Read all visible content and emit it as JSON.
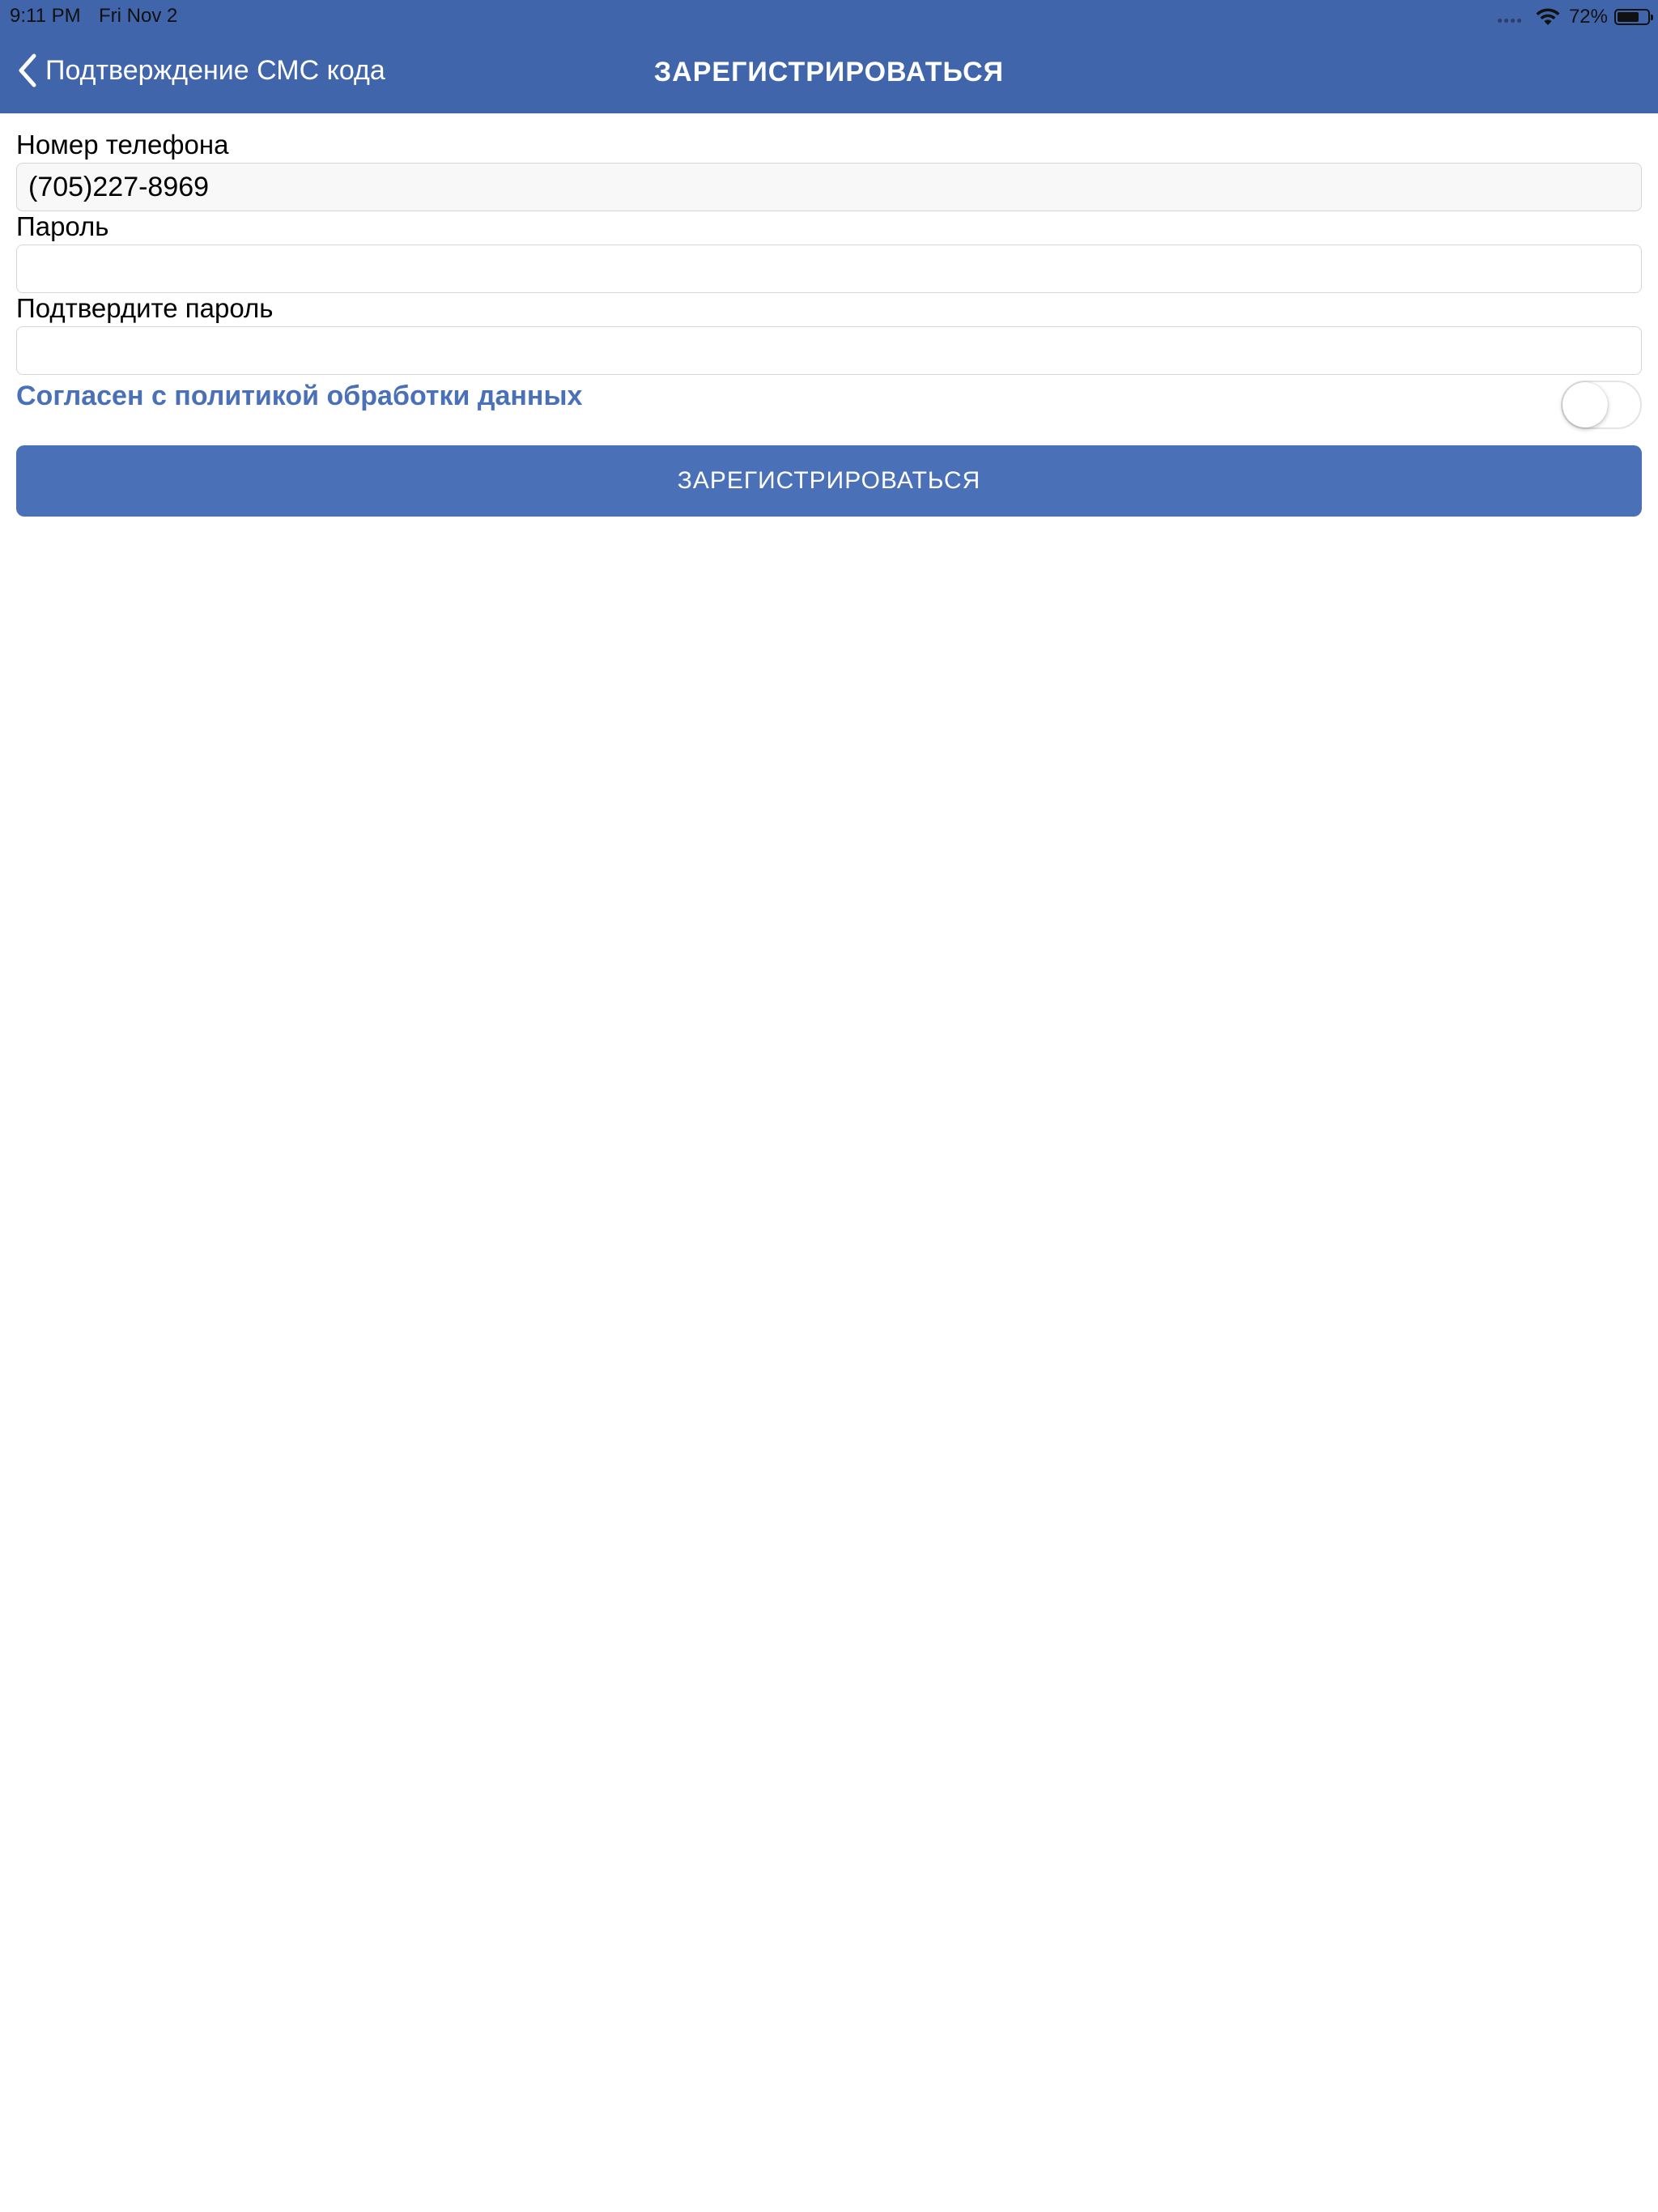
{
  "status_bar": {
    "time": "9:11 PM",
    "date": "Fri Nov 2",
    "battery_percent": "72%",
    "battery_level": 0.72,
    "icons": [
      "signal-dots-icon",
      "wifi-icon",
      "battery-icon"
    ]
  },
  "nav": {
    "back_label": "Подтверждение СМС кода",
    "title": "ЗАРЕГИСТРИРОВАТЬСЯ",
    "back_icon": "chevron-left-icon"
  },
  "form": {
    "phone": {
      "label": "Номер телефона",
      "value": "(705)227-8969"
    },
    "password": {
      "label": "Пароль",
      "value": ""
    },
    "confirm_password": {
      "label": "Подтвердите пароль",
      "value": ""
    },
    "consent": {
      "label": "Согласен с политикой обработки данных",
      "checked": false
    },
    "submit_label": "ЗАРЕГИСТРИРОВАТЬСЯ"
  },
  "colors": {
    "header_bg": "#4065ab",
    "accent": "#4a70b8",
    "text": "#000000",
    "field_border": "#d6d6d6",
    "readonly_field_bg": "#f8f8f8"
  }
}
